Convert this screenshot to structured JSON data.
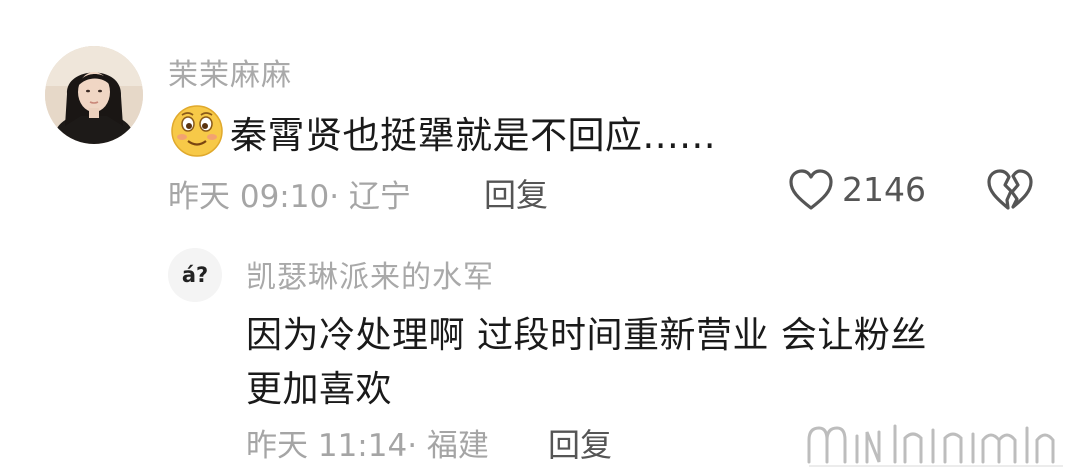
{
  "comment": {
    "username": "茉茉麻麻",
    "emoji_icon": "smiley-blush-emoji",
    "text": "秦霄贤也挺犟就是不回应......",
    "time_location": "昨天 09:10· 辽宁",
    "reply_label": "回复",
    "like_icon": "heart-outline-icon",
    "like_count": "2146",
    "dislike_icon": "broken-heart-icon"
  },
  "reply": {
    "avatar_text": "á?",
    "username": "凯瑟琳派来的水军",
    "text_line1": "因为冷处理啊 过段时间重新营业 会让粉丝",
    "text_line2": "更加喜欢",
    "time_location": "昨天 11:14· 福建",
    "reply_label": "回复"
  },
  "colors": {
    "muted_text": "#a5a5a5",
    "body_text": "#1a1a1a",
    "action_text": "#555555",
    "emoji_yellow": "#f7c948"
  }
}
